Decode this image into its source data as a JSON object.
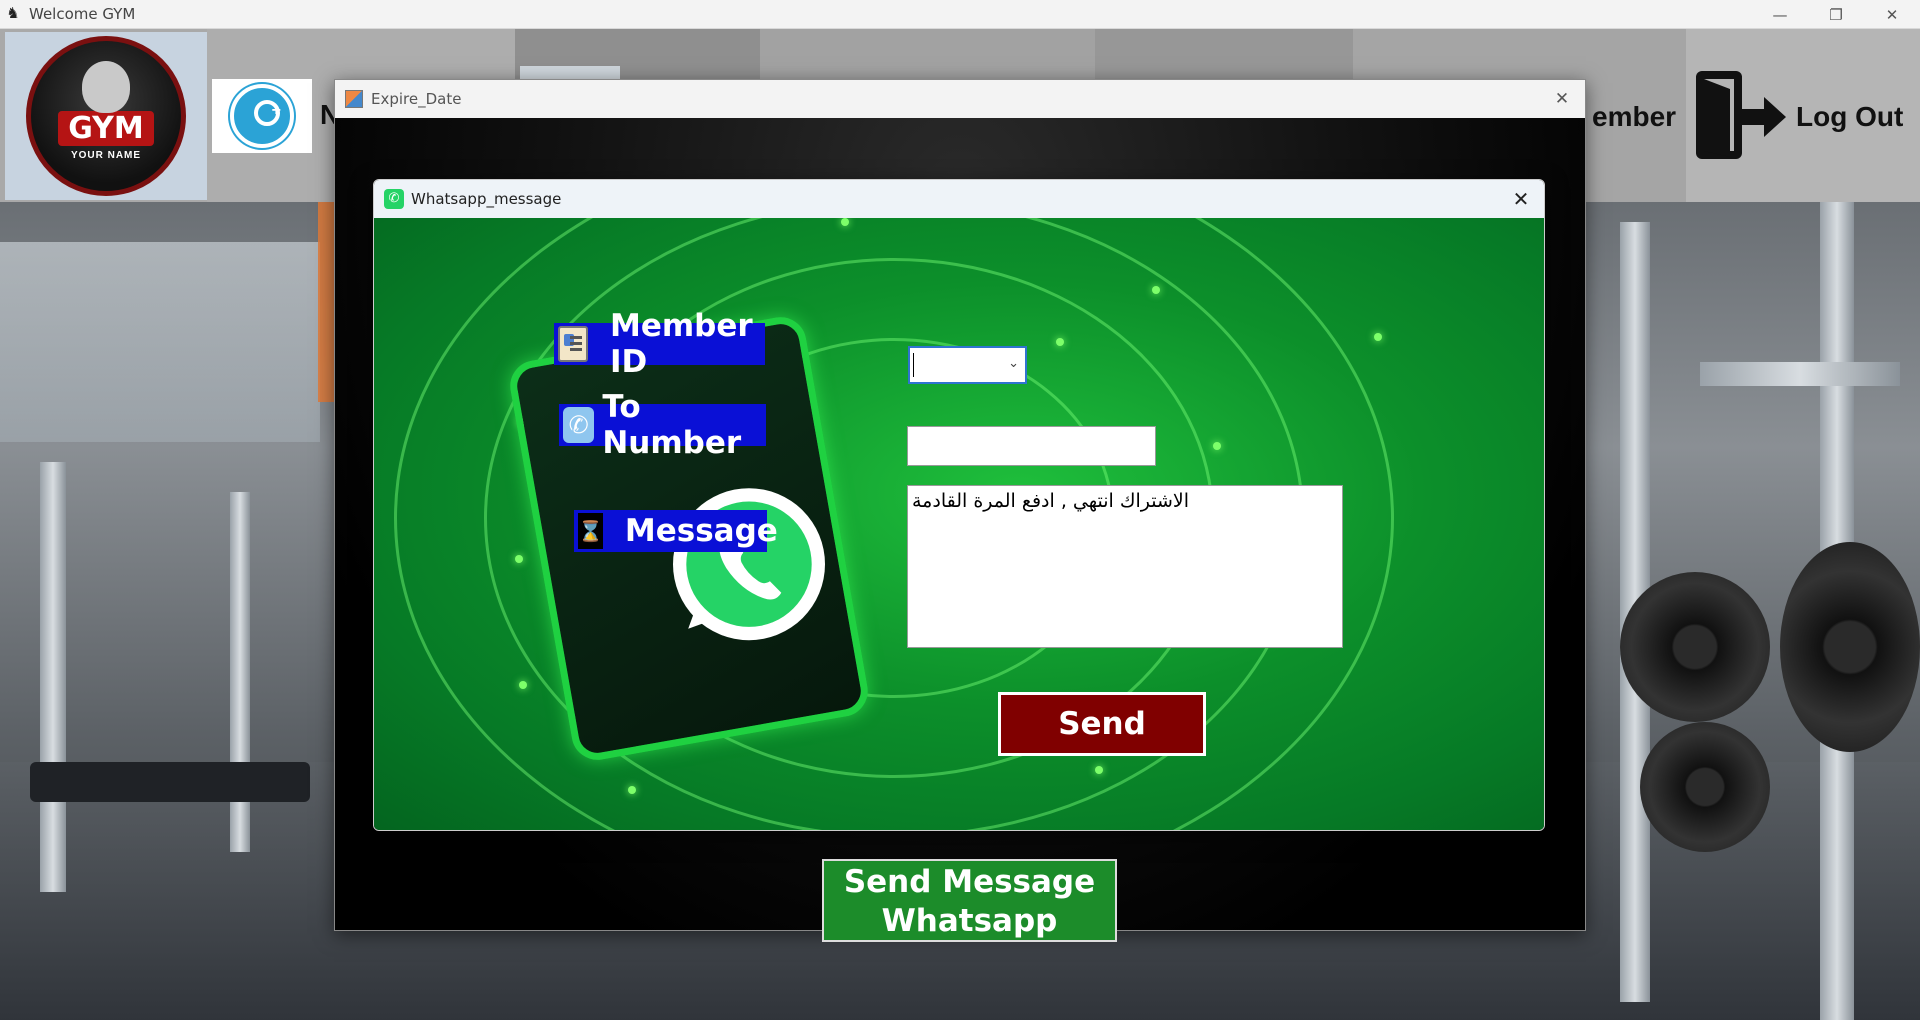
{
  "main_window": {
    "title": "Welcome GYM",
    "controls": {
      "minimize": "—",
      "restore": "❐",
      "close": "✕"
    }
  },
  "navbar": {
    "logo": {
      "text": "GYM",
      "subtext": "YOUR NAME"
    },
    "add_member_label_fragment": "N",
    "member_label_fragment": "ember",
    "logout_label": "Log Out"
  },
  "expire_window": {
    "title": "Expire_Date",
    "close": "✕",
    "send_whatsapp_line1": "Send Message",
    "send_whatsapp_line2": "Whatsapp"
  },
  "whatsapp_dialog": {
    "title": "Whatsapp_message",
    "close": "✕",
    "member_id_label": "Member ID",
    "to_number_label": "To Number",
    "message_label": "Message",
    "member_id_value": "",
    "to_number_value": "",
    "message_value": "الاشتراك انتهي , ادفع المرة القادمة",
    "send_label": "Send",
    "colors": {
      "label_bg": "#0a10d6",
      "send_bg": "#800000",
      "accent": "#1fd141"
    }
  }
}
